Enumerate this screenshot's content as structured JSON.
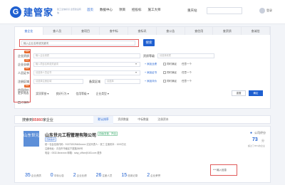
{
  "header": {
    "logo_glyph": "G",
    "logo_text": "建管家",
    "slogan": "建工全信标识 企查建设有信",
    "nav": [
      "首页",
      "数据中心",
      "项目",
      "招投标",
      "施工大师"
    ],
    "nav_active_index": 0,
    "city": "重庆站",
    "user_label": "登录"
  },
  "panel": {
    "tabs": [
      "查企业",
      "查人员",
      "查项目",
      "查中标",
      "查标讯",
      "查公告",
      "查信用",
      "查资质",
      "查诚信"
    ],
    "active_tab_index": 0,
    "search_placeholder": "输入企业名称或关键词",
    "search_button": "搜索",
    "filters": [
      {
        "label": "企业资质",
        "badge": "new",
        "placeholder": "输入企业资质",
        "right_label": "资质等级",
        "right_placeholder": "请选择资质",
        "options": []
      },
      {
        "label": "企业业绩",
        "badge": "new",
        "placeholder": "输入项目名称或关键词",
        "right_label": "+ 添加业绩",
        "right_placeholder": "",
        "options": [
          "同时满足",
          "任意一个"
        ]
      },
      {
        "label": "人员证书",
        "badge": "new",
        "placeholder": "请选择人员证书",
        "right_label": "+ 添加证书",
        "right_placeholder": "",
        "options": [
          "同时满足",
          "任意一个"
        ]
      },
      {
        "label": "注册区域",
        "badge": "",
        "placeholder": "请选择注册区域",
        "right_label": "备案区域",
        "right_placeholder": "请选择",
        "options": []
      },
      {
        "label": "信用评价",
        "badge": "new",
        "placeholder": "",
        "right_label": "+ 添加评价",
        "right_placeholder": "",
        "options": [
          "同时满足",
          "任意一个"
        ]
      }
    ],
    "more_filters": [
      "更多筛选",
      "奖项荣誉 ▾",
      "良好行为 ▾",
      "信用等级 ▾",
      "企业类型 ▾"
    ],
    "reset_button": "重置",
    "confirm_button": "确定",
    "saved_label": "已保存"
  },
  "results": {
    "prefix": "搜索到",
    "count": "85860",
    "suffix": "家企业",
    "tabs": [
      "默认排序",
      "资质数量",
      "中标数量",
      "注册资本"
    ],
    "active_tab_index": 0
  },
  "card": {
    "logo_text": "山东世元",
    "name": "山东世元工程管理有限公司",
    "status": "存续(在营、开业)",
    "tag": "高新技术",
    "info_lines": [
      "统一社会信用代码：91370202MA3xxxxx   法定代表人：张三   注册资本：1000万元",
      "注册地址：青岛市市南区宁夏路288号",
      "电话：0532-8xxxxxxx   邮箱：sdsy_office@163.com   更多"
    ],
    "score_label": "公司评分",
    "score_value": "73",
    "score_unit": "分",
    "score_sub": "超过了85%的企业",
    "stats": [
      {
        "value": "35",
        "label": "企业资质"
      },
      {
        "value": "0",
        "label": "中标公告"
      },
      {
        "value": "2",
        "label": "企业业绩"
      },
      {
        "value": "26",
        "label": "注册人员"
      },
      {
        "value": "15",
        "label": "信用记录"
      },
      {
        "value": "2",
        "label": "企业荣誉"
      }
    ],
    "extra_label": "*** 输入信息"
  },
  "colors": {
    "brand": "#1e5fd0",
    "highlight_border": "#e05a5a",
    "badge": "#e86a2c"
  }
}
